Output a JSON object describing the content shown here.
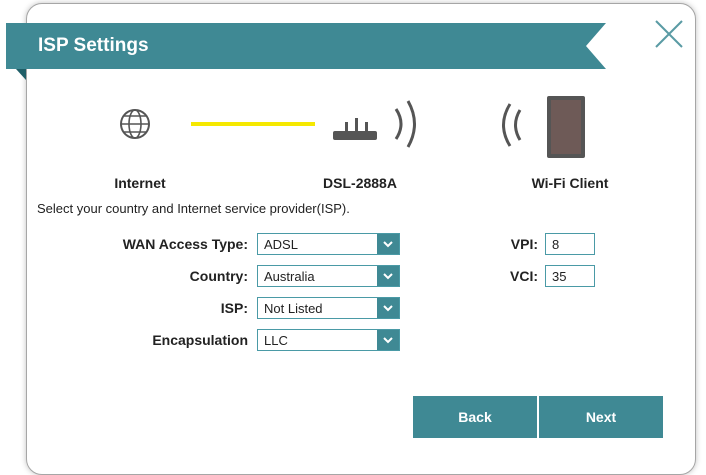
{
  "dialog": {
    "title": "ISP Settings",
    "close_icon": "close-icon"
  },
  "diagram": {
    "internet_label": "Internet",
    "router_label": "DSL-2888A",
    "client_label": "Wi-Fi Client",
    "icons": [
      "globe-icon",
      "router-icon",
      "wifi-signal-icon",
      "tablet-icon"
    ]
  },
  "intro_text": "Select your country and Internet service provider(ISP).",
  "form": {
    "wan_access_type": {
      "label": "WAN Access Type:",
      "value": "ADSL"
    },
    "country": {
      "label": "Country:",
      "value": "Australia"
    },
    "isp": {
      "label": "ISP:",
      "value": "Not Listed"
    },
    "encapsulation": {
      "label": "Encapsulation",
      "value": "LLC"
    },
    "vpi": {
      "label": "VPI:",
      "value": "8"
    },
    "vci": {
      "label": "VCI:",
      "value": "35"
    }
  },
  "buttons": {
    "back": "Back",
    "next": "Next"
  },
  "colors": {
    "accent": "#3f8994",
    "link_line": "#f5e800",
    "banner": "#3f8994"
  }
}
